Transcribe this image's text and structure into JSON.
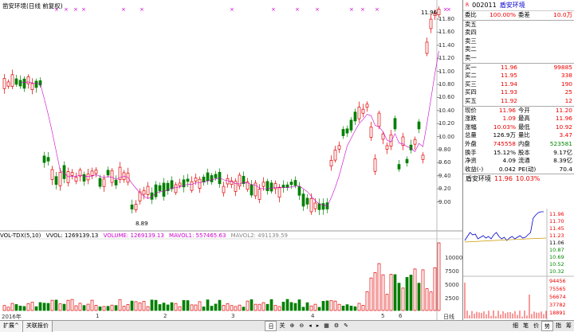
{
  "chart_title": "凿安环境(日线 前复权)",
  "vol_title": "VOL-TDX(5,10)",
  "vol_label": "VVOL: 1269139.13",
  "vol_ma_labels": [
    "VOLUME: 1269139.13",
    "MAVOL1: 557465.63",
    "MAVOL2: 491139.59"
  ],
  "price_labels": [
    "11.96",
    "8.89"
  ],
  "price_axis": [
    "11.80",
    "11.60",
    "11.40",
    "11.20",
    "11.00",
    "10.80",
    "10.60",
    "10.40",
    "10.20",
    "10.00",
    "9.80",
    "9.60",
    "9.40",
    "9.20",
    "9.00"
  ],
  "vol_axis": [
    "10000",
    "7500",
    "5000",
    "2500"
  ],
  "x_labels": [
    "2016年",
    "1",
    "2",
    "3",
    "4",
    "5",
    "6",
    "日线"
  ],
  "colors": {
    "up": "#e00000",
    "down": "#008000",
    "ma5": "#888888",
    "ma10": "#cc00cc"
  },
  "header": {
    "icon": "R",
    "code": "002011",
    "name": "盾安环境"
  },
  "weibi": {
    "label": "委比",
    "value": "100.00%",
    "label2": "委差",
    "value2": "10.0万"
  },
  "sell": [
    {
      "label": "卖五",
      "price": "",
      "vol": ""
    },
    {
      "label": "卖四",
      "price": "",
      "vol": ""
    },
    {
      "label": "卖三",
      "price": "",
      "vol": ""
    },
    {
      "label": "卖二",
      "price": "",
      "vol": ""
    },
    {
      "label": "卖一",
      "price": "",
      "vol": ""
    }
  ],
  "buy": [
    {
      "label": "买一",
      "price": "11.96",
      "vol": "99885"
    },
    {
      "label": "买二",
      "price": "11.95",
      "vol": "338"
    },
    {
      "label": "买三",
      "price": "11.94",
      "vol": "190"
    },
    {
      "label": "买四",
      "price": "11.93",
      "vol": "25"
    },
    {
      "label": "买五",
      "price": "11.92",
      "vol": "12"
    }
  ],
  "stats": [
    {
      "l1": "现价",
      "v1": "11.96",
      "l2": "今开",
      "v2": "11.20",
      "c1": "red",
      "c2": "red"
    },
    {
      "l1": "涨跌",
      "v1": "1.09",
      "l2": "最高",
      "v2": "11.96",
      "c1": "red",
      "c2": "red"
    },
    {
      "l1": "涨幅",
      "v1": "10.03%",
      "l2": "最低",
      "v2": "10.92",
      "c1": "red",
      "c2": "red"
    },
    {
      "l1": "总量",
      "v1": "126.9万",
      "l2": "量比",
      "v2": "3.47",
      "c1": "",
      "c2": "red"
    },
    {
      "l1": "外盘",
      "v1": "745558",
      "l2": "内盘",
      "v2": "523581",
      "c1": "red",
      "c2": "green"
    },
    {
      "l1": "换手",
      "v1": "15.12%",
      "l2": "股本",
      "v2": "9.17亿",
      "c1": "",
      "c2": ""
    },
    {
      "l1": "净资",
      "v1": "4.09",
      "l2": "流通",
      "v2": "8.39亿",
      "c1": "",
      "c2": ""
    },
    {
      "l1": "收益(-)",
      "v1": "0.042",
      "l2": "PE(动)",
      "v2": "70.4",
      "c1": "",
      "c2": ""
    }
  ],
  "mini": {
    "name": "盾安环境",
    "price": "11.96",
    "pct": "10.03%",
    "price_axis": [
      "11.96",
      "11.70",
      "11.45",
      "11.23",
      "11.06",
      "10.87",
      "10.69",
      "10.52",
      "10.32"
    ],
    "vol_axis": [
      "94456",
      "75565",
      "56674",
      "37782",
      "18891"
    ]
  },
  "status": {
    "tabs": [
      "扩展^",
      "关联报价"
    ],
    "tools": [
      "日",
      "关",
      "",
      "",
      "",
      "",
      "",
      "",
      "",
      ""
    ],
    "right_tabs": [
      "细",
      "笔",
      "价",
      "势",
      "指",
      "筹"
    ]
  }
}
